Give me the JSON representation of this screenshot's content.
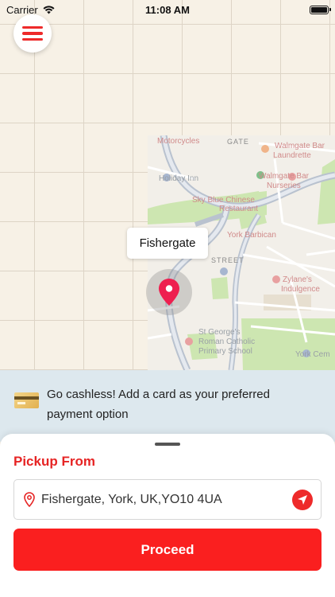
{
  "status_bar": {
    "carrier": "Carrier",
    "time": "11:08 AM"
  },
  "map": {
    "labels": {
      "motorcycles": "Motorcycles",
      "gate": "GATE",
      "walmgate_bar": "Walmgate Bar",
      "laundrette": "Laundrette",
      "walmgate_bar_2": "Walmgate Bar",
      "nurseries": "Nurseries",
      "holiday_inn": "Holiday Inn",
      "sky_blue": "Sky Blue Chinese",
      "restaurant": "Restaurant",
      "york_barbican": "York Barbican",
      "street": "STREET",
      "zylanes": "Zylane's",
      "indulgence": "Indulgence",
      "school_1": "St George's",
      "school_2": "Roman Catholic",
      "school_3": "Primary School",
      "york_cemetery": "York Cem"
    },
    "callout": "Fishergate",
    "colors": {
      "pin": "#ee1f4f",
      "park": "#cde6b1",
      "road": "#b9c2cf"
    }
  },
  "banner": {
    "icon": "credit-card-icon",
    "text_line1": "Go cashless! Add a card as your preferred",
    "text_line2": "payment option"
  },
  "sheet": {
    "pickup_title": "Pickup From",
    "address": "Fishergate, York, UK,YO10 4UA",
    "proceed_label": "Proceed"
  },
  "colors": {
    "accent": "#ee2a2a",
    "banner_bg": "#dde8ee"
  }
}
